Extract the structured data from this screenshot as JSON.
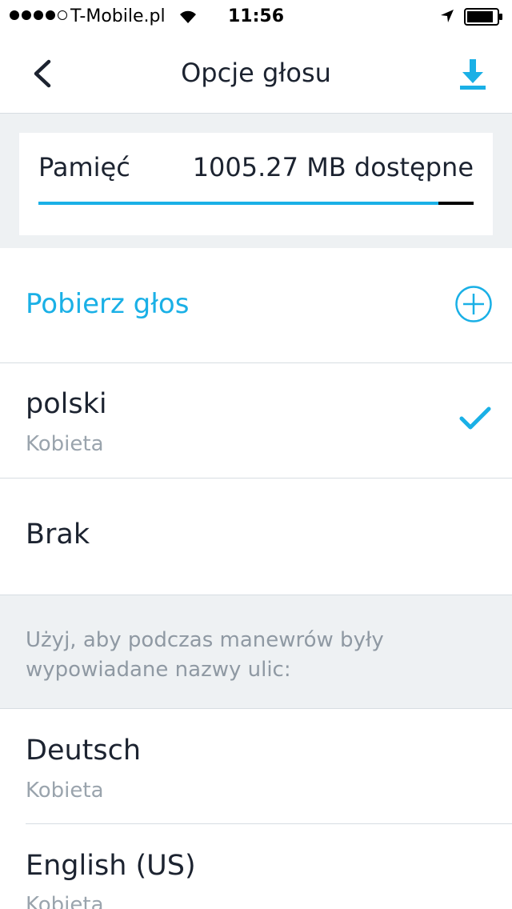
{
  "status_bar": {
    "carrier": "T-Mobile.pl",
    "time": "11:56"
  },
  "nav": {
    "title": "Opcje głosu",
    "back_icon": "chevron-left-icon",
    "download_icon": "download-icon"
  },
  "memory": {
    "label": "Pamięć",
    "value": "1005.27 MB dostępne",
    "available_fraction": 0.92
  },
  "download_voice": {
    "label": "Pobierz głos",
    "icon": "plus-circle-icon"
  },
  "voices": [
    {
      "name": "polski",
      "gender": "Kobieta",
      "selected": true
    },
    {
      "name": "Brak",
      "selected": false
    }
  ],
  "street_names_info": "Użyj, aby podczas manewrów były wypowiadane nazwy ulic:",
  "street_voices": [
    {
      "name": "Deutsch",
      "gender": "Kobieta"
    },
    {
      "name": "English (US)",
      "gender": "Kobieta"
    }
  ],
  "colors": {
    "accent": "#1ab0e6",
    "text": "#1c2330",
    "secondary_text": "#9aa4ad",
    "section_bg": "#eef1f3"
  }
}
